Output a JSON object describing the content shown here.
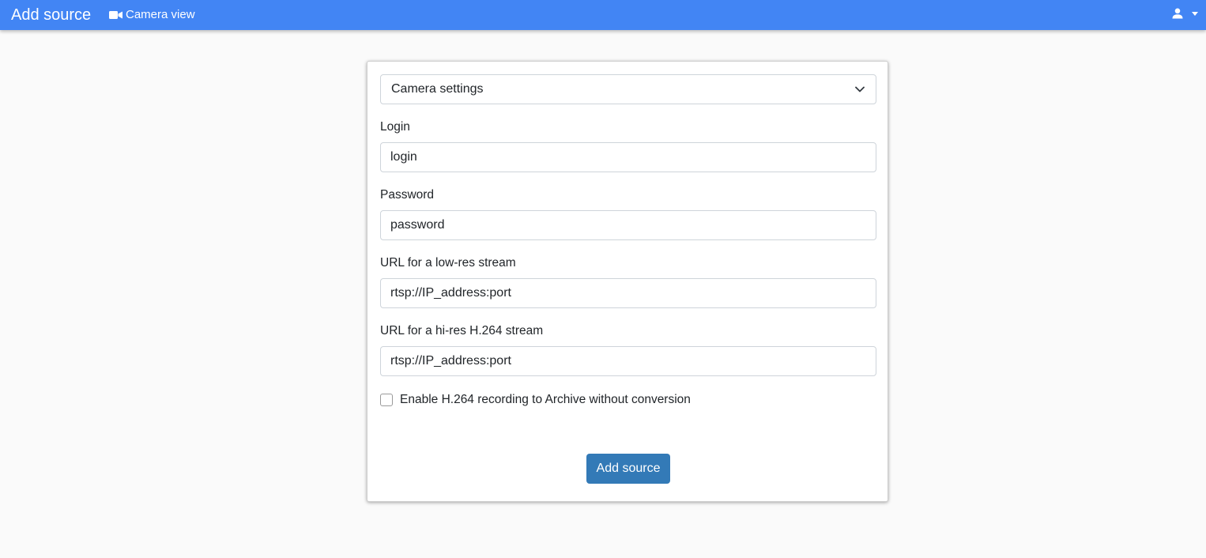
{
  "header": {
    "title": "Add source",
    "nav_link_label": "Camera view",
    "nav_link_icon": "video-camera-icon",
    "user_icon": "user-icon",
    "accent_color": "#4285f4"
  },
  "form": {
    "settings_select": {
      "selected": "Camera settings"
    },
    "login": {
      "label": "Login",
      "placeholder": "login",
      "value": ""
    },
    "password": {
      "label": "Password",
      "placeholder": "password",
      "value": ""
    },
    "lowres_url": {
      "label": "URL for a low-res stream",
      "placeholder": "rtsp://IP_address:port",
      "value": ""
    },
    "hires_url": {
      "label": "URL for a hi-res H.264 stream",
      "placeholder": "rtsp://IP_address:port",
      "value": ""
    },
    "h264_recording": {
      "label": "Enable H.264 recording to Archive without conversion",
      "checked": false
    },
    "submit_label": "Add source",
    "submit_color": "#337ab7"
  }
}
